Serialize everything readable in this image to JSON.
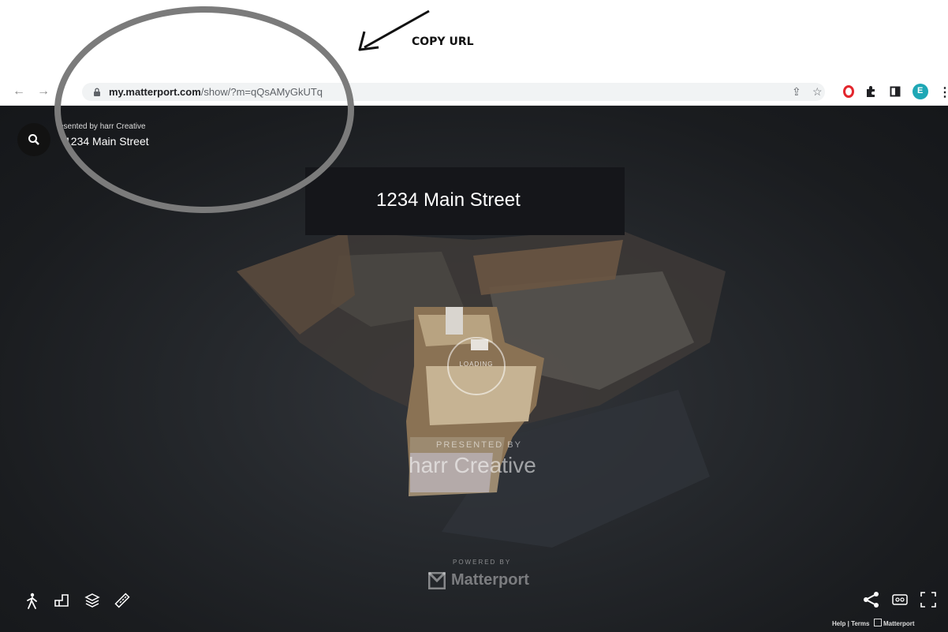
{
  "annotation": {
    "label": "COPY URL"
  },
  "browser": {
    "url_host": "my.matterport.com",
    "url_path": "/show/?m=qQsAMyGkUTq",
    "profile_initial": "E",
    "icons": [
      "back-arrow-icon",
      "forward-arrow-icon",
      "lock-icon",
      "share-icon",
      "bookmark-star-icon",
      "opera-icon",
      "extensions-puzzle-icon",
      "sidebar-icon",
      "profile-avatar-icon",
      "menu-kebab-icon"
    ]
  },
  "viewer": {
    "presented_by_small": "esented by harr Creative",
    "title_small": "1234 Main Street",
    "banner_title": "1234 Main Street",
    "loading": "LOADING",
    "presented_by": "PRESENTED BY",
    "brand": "harr Creative",
    "powered_by": "POWERED BY",
    "matterport": "Matterport",
    "footer": {
      "help": "Help",
      "sep": "|",
      "terms": "Terms",
      "brand": "Matterport"
    },
    "tools": [
      "walk-icon",
      "floorplan-icon",
      "layers-icon",
      "measure-icon"
    ],
    "right_tools": [
      "share-icon",
      "vr-icon",
      "fullscreen-icon"
    ]
  },
  "colors": {
    "annotation_ring": "#7b7b7b",
    "viewer_bg": "#1c1e21"
  }
}
